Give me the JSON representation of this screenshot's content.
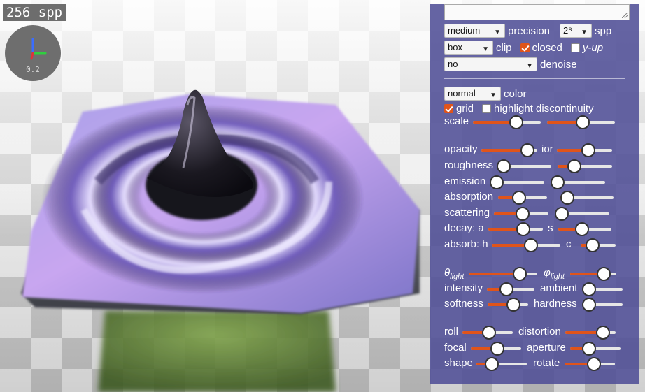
{
  "overlay": {
    "spp_text": "256 spp",
    "gizmo_value": "0.2"
  },
  "panel": {
    "quality": {
      "precision_value": "medium",
      "precision_label": "precision",
      "spp_value": "2⁸",
      "spp_label": "spp"
    },
    "clip": {
      "value": "box",
      "label": "clip",
      "closed_label": "closed",
      "closed_checked": true,
      "yup_label": "y-up",
      "yup_checked": false
    },
    "denoise": {
      "value": "no",
      "label": "denoise"
    },
    "color": {
      "value": "normal",
      "label": "color"
    },
    "grid": {
      "label": "grid",
      "checked": true,
      "highlight_label": "highlight discontinuity",
      "highlight_checked": false
    },
    "scale": {
      "label": "scale",
      "value1": 0.62,
      "value2": 0.5
    },
    "material": {
      "opacity": {
        "label": "opacity",
        "value": 0.8
      },
      "ior": {
        "label": "ior",
        "value": 0.55
      },
      "roughness": {
        "label": "roughness",
        "value": 0.0
      },
      "roughness2": {
        "value": 0.28
      },
      "emission": {
        "label": "emission",
        "value": 0.0
      },
      "emission2": {
        "value": 0.0
      },
      "absorption": {
        "label": "absorption",
        "value": 0.4
      },
      "absorption2": {
        "value": 0.12
      },
      "scattering": {
        "label": "scattering",
        "value": 0.5
      },
      "scattering2": {
        "value": 0.0
      },
      "decay_a": {
        "label": "decay: a",
        "value": 0.62
      },
      "decay_s": {
        "label": "s",
        "value": 0.42
      },
      "absorb_h": {
        "label": "absorb: h",
        "value": 0.55
      },
      "absorb_c": {
        "label": "c",
        "value": 0.3
      }
    },
    "light": {
      "theta": {
        "label": "θ",
        "sub": "light",
        "value": 0.72
      },
      "phi": {
        "label": "φ",
        "sub": "light",
        "value": 0.7
      },
      "intensity": {
        "label": "intensity",
        "value": 0.38
      },
      "ambient": {
        "label": "ambient",
        "value": 0.0
      },
      "softness": {
        "label": "softness",
        "value": 0.6
      },
      "hardness": {
        "label": "hardness",
        "value": 0.0
      }
    },
    "camera": {
      "roll": {
        "label": "roll",
        "value": 0.5
      },
      "distortion": {
        "label": "distortion",
        "value": 0.72
      },
      "focal": {
        "label": "focal",
        "value": 0.5
      },
      "aperture": {
        "label": "aperture",
        "value": 0.35
      },
      "shape": {
        "label": "shape",
        "value": 0.28
      },
      "rotate": {
        "label": "rotate",
        "value": 0.55
      }
    }
  },
  "colors": {
    "accent": "#e0541a",
    "panel_bg": "#504e96"
  }
}
